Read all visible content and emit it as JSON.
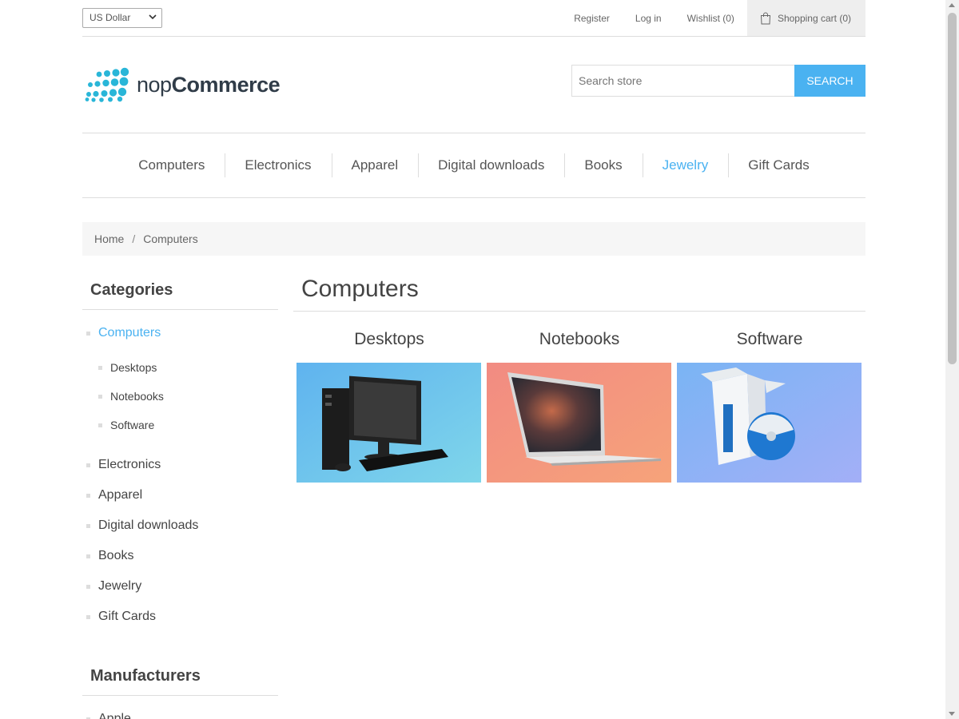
{
  "header": {
    "currency": "US Dollar",
    "links": [
      "Register",
      "Log in",
      "Wishlist (0)"
    ],
    "cart_label": "Shopping cart (0)"
  },
  "logo": {
    "light": "nop",
    "bold": "Commerce"
  },
  "search": {
    "placeholder": "Search store",
    "button": "SEARCH"
  },
  "menu": {
    "items": [
      "Computers",
      "Electronics",
      "Apparel",
      "Digital downloads",
      "Books",
      "Jewelry",
      "Gift Cards"
    ],
    "active": "Jewelry"
  },
  "breadcrumb": {
    "home": "Home",
    "separator": "/",
    "current": "Computers"
  },
  "sidebar": {
    "categories_title": "Categories",
    "categories": [
      {
        "label": "Computers",
        "active": true,
        "children": [
          "Desktops",
          "Notebooks",
          "Software"
        ]
      },
      {
        "label": "Electronics"
      },
      {
        "label": "Apparel"
      },
      {
        "label": "Digital downloads"
      },
      {
        "label": "Books"
      },
      {
        "label": "Jewelry"
      },
      {
        "label": "Gift Cards"
      }
    ],
    "manufacturers_title": "Manufacturers",
    "manufacturers": [
      "Apple"
    ]
  },
  "main": {
    "title": "Computers",
    "subcategories": [
      "Desktops",
      "Notebooks",
      "Software"
    ]
  },
  "colors": {
    "accent": "#4ab2f1",
    "text": "#444444"
  }
}
